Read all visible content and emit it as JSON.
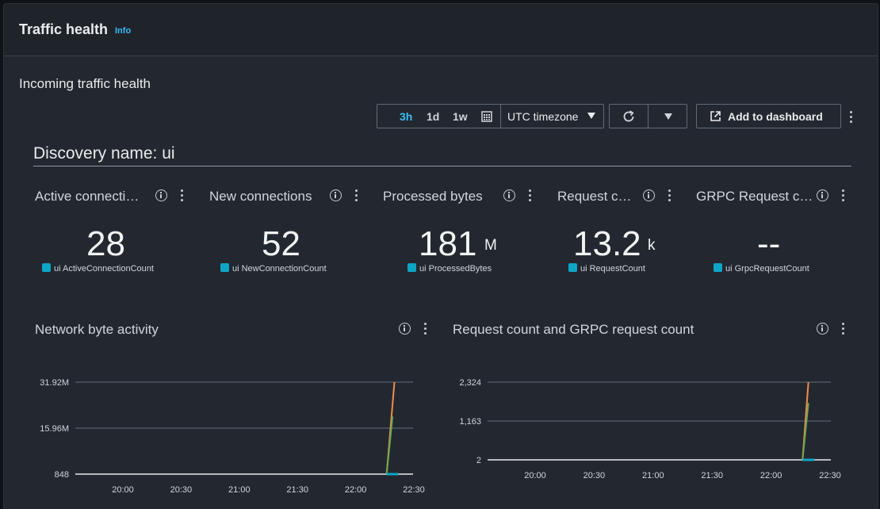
{
  "panel": {
    "title": "Traffic health",
    "info_label": "Info"
  },
  "section": {
    "title": "Incoming traffic health"
  },
  "controls": {
    "ranges": [
      "3h",
      "1d",
      "1w"
    ],
    "active_range": "3h",
    "timezone": "UTC timezone",
    "add_to_dashboard": "Add to dashboard",
    "accent_color": "#38bdf8"
  },
  "discovery": {
    "title": "Discovery name: ui"
  },
  "metrics": [
    {
      "title": "Active connecti…",
      "value": "28",
      "unit": "",
      "legend": "ui ActiveConnectionCount"
    },
    {
      "title": "New connections",
      "value": "52",
      "unit": "",
      "legend": "ui NewConnectionCount"
    },
    {
      "title": "Processed bytes",
      "value": "181",
      "unit": "M",
      "legend": "ui ProcessedBytes"
    },
    {
      "title": "Request c…",
      "value": "13.2",
      "unit": "k",
      "legend": "ui RequestCount"
    },
    {
      "title": "GRPC Request c…",
      "value": "--",
      "unit": "",
      "legend": "ui GrpcRequestCount"
    }
  ],
  "chart_data": [
    {
      "type": "line",
      "title": "Network byte activity",
      "y_ticks": [
        "31.92M",
        "15.96M",
        "848"
      ],
      "ylim": [
        848,
        31920000
      ],
      "x_ticks": [
        "20:00",
        "20:30",
        "21:00",
        "21:30",
        "22:00",
        "22:30"
      ],
      "series": [
        {
          "color": "#f28c4b",
          "x": [
            "22:16",
            "22:20"
          ],
          "y": [
            848,
            31920000
          ]
        },
        {
          "color": "#6aa84f",
          "x": [
            "22:16",
            "22:19"
          ],
          "y": [
            848,
            20000000
          ]
        },
        {
          "color": "#0ea5c6",
          "x": [
            "22:16",
            "22:22"
          ],
          "y": [
            848,
            848
          ]
        }
      ]
    },
    {
      "type": "line",
      "title": "Request count and GRPC request count",
      "y_ticks": [
        "2,324",
        "1,163",
        "2"
      ],
      "ylim": [
        2,
        2324
      ],
      "x_ticks": [
        "20:00",
        "20:30",
        "21:00",
        "21:30",
        "22:00",
        "22:30"
      ],
      "series": [
        {
          "color": "#f28c4b",
          "x": [
            "22:16",
            "22:19"
          ],
          "y": [
            2,
            2324
          ]
        },
        {
          "color": "#6aa84f",
          "x": [
            "22:16",
            "22:19"
          ],
          "y": [
            2,
            1700
          ]
        },
        {
          "color": "#0ea5c6",
          "x": [
            "22:16",
            "22:22"
          ],
          "y": [
            2,
            2
          ]
        }
      ]
    }
  ]
}
